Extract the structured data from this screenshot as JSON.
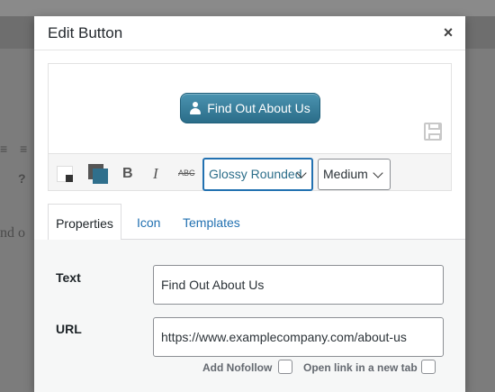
{
  "background": {
    "text": "nd o"
  },
  "dialog": {
    "title": "Edit Button",
    "close_label": "×"
  },
  "preview": {
    "button_label": "Find Out About Us",
    "button_icon": "user-icon",
    "save_icon": "save-icon"
  },
  "toolbar": {
    "bold": "B",
    "italic": "I",
    "strike": "ABC",
    "style_value": "Glossy Rounded",
    "size_value": "Medium"
  },
  "tabs": [
    {
      "label": "Properties",
      "active": true
    },
    {
      "label": "Icon",
      "active": false
    },
    {
      "label": "Templates",
      "active": false
    }
  ],
  "properties": {
    "text_label": "Text",
    "text_value": "Find Out About Us",
    "url_label": "URL",
    "url_value": "https://www.examplecompany.com/about-us",
    "nofollow_label": "Add Nofollow",
    "nofollow_checked": false,
    "new_tab_label": "Open link in a new tab",
    "new_tab_checked": false
  },
  "colors": {
    "accent": "#2271b1",
    "button_fill": "#2b6d89",
    "panel_bg": "#f6f7f7"
  }
}
